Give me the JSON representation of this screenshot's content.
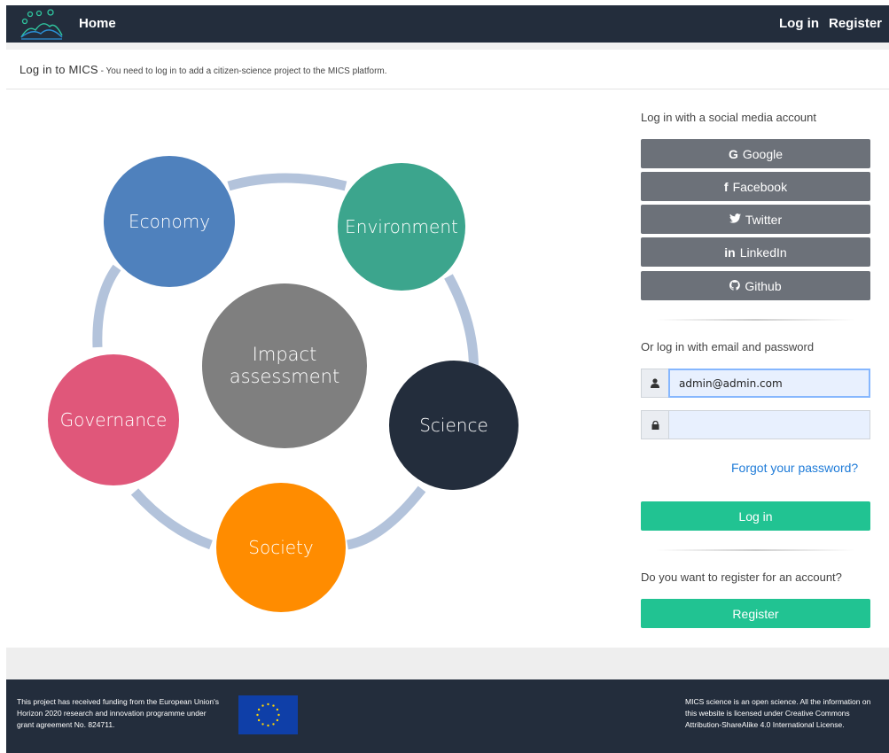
{
  "nav": {
    "home": "Home",
    "login": "Log in",
    "register": "Register"
  },
  "header": {
    "title": "Log in to MICS",
    "subtitle": " - You need to log in to add a citizen-science project to the MICS platform."
  },
  "diagram": {
    "center": [
      "Impact",
      "assessment"
    ],
    "nodes": {
      "economy": "Economy",
      "environment": "Environment",
      "science": "Science",
      "society": "Society",
      "governance": "Governance"
    },
    "colors": {
      "economy": "#4f81bd",
      "environment": "#3ca58d",
      "science": "#232d3c",
      "society": "#ff8c00",
      "governance": "#e0577a",
      "center": "#7f7f7f",
      "ring": "#b3c3db"
    }
  },
  "login": {
    "social_label": "Log in with a social media account",
    "social": [
      {
        "icon": "G",
        "label": "Google"
      },
      {
        "icon": "f",
        "label": "Facebook"
      },
      {
        "icon": "🐦",
        "label": "Twitter"
      },
      {
        "icon": "in",
        "label": "LinkedIn"
      },
      {
        "icon": "●",
        "label": "Github"
      }
    ],
    "email_label": "Or log in with email and password",
    "email_value": "admin@admin.com",
    "password_value": "",
    "forgot": "Forgot your password?",
    "login_button": "Log in",
    "register_label": "Do you want to register for an account?",
    "register_button": "Register"
  },
  "footer": {
    "left": "This project has received funding from the European Union's Horizon 2020 research and innovation programme under grant agreement No. 824711.",
    "right": "MICS science is an open science. All the information on this website is licensed under Creative Commons Attribution-ShareAlike 4.0 International License."
  },
  "colors": {
    "navbar": "#232d3c",
    "accent_green": "#21c392",
    "social_button": "#6c7179",
    "link_blue": "#1e7bd8"
  }
}
